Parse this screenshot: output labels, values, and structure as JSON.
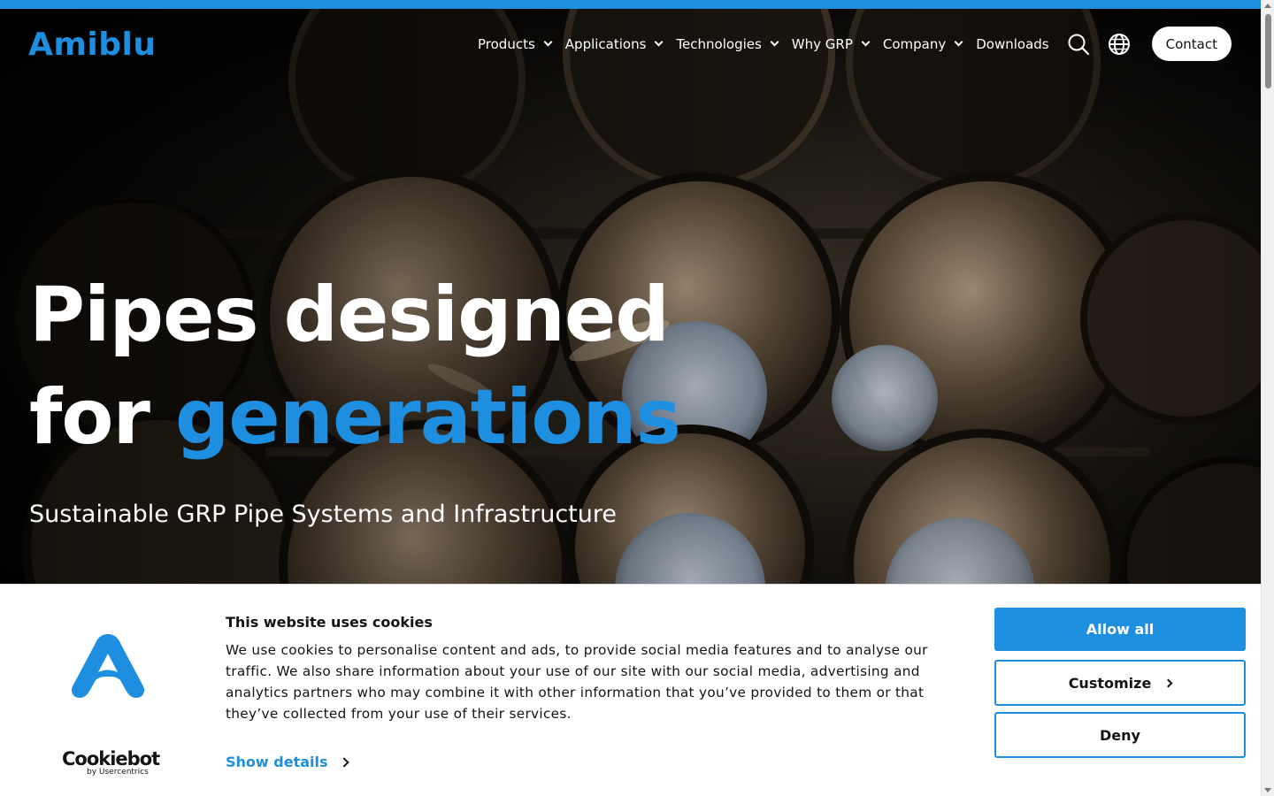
{
  "brand": {
    "logo_text": "Amiblu",
    "accent_color": "#1e8fe0"
  },
  "nav": {
    "items": [
      {
        "label": "Products",
        "has_dropdown": true
      },
      {
        "label": "Applications",
        "has_dropdown": true
      },
      {
        "label": "Technologies",
        "has_dropdown": true
      },
      {
        "label": "Why GRP",
        "has_dropdown": true
      },
      {
        "label": "Company",
        "has_dropdown": true
      },
      {
        "label": "Downloads",
        "has_dropdown": false
      }
    ],
    "icons": [
      "search-icon",
      "globe-icon"
    ],
    "contact_label": "Contact"
  },
  "hero": {
    "headline_line1": "Pipes designed",
    "headline_line2_prefix": "for ",
    "headline_accent": "generations",
    "subheading": "Sustainable GRP Pipe Systems and Infrastructure"
  },
  "cookie_banner": {
    "title": "This website uses cookies",
    "body": "We use cookies to personalise content and ads, to provide social media features and to analyse our traffic. We also share information about your use of our site with our social media, advertising and analytics partners who may combine it with other information that you’ve provided to them or that they’ve collected from your use of their services.",
    "show_details_label": "Show details",
    "provider_name": "Cookiebot",
    "provider_sub": "by Usercentrics",
    "allow_all_label": "Allow all",
    "customize_label": "Customize",
    "deny_label": "Deny"
  }
}
